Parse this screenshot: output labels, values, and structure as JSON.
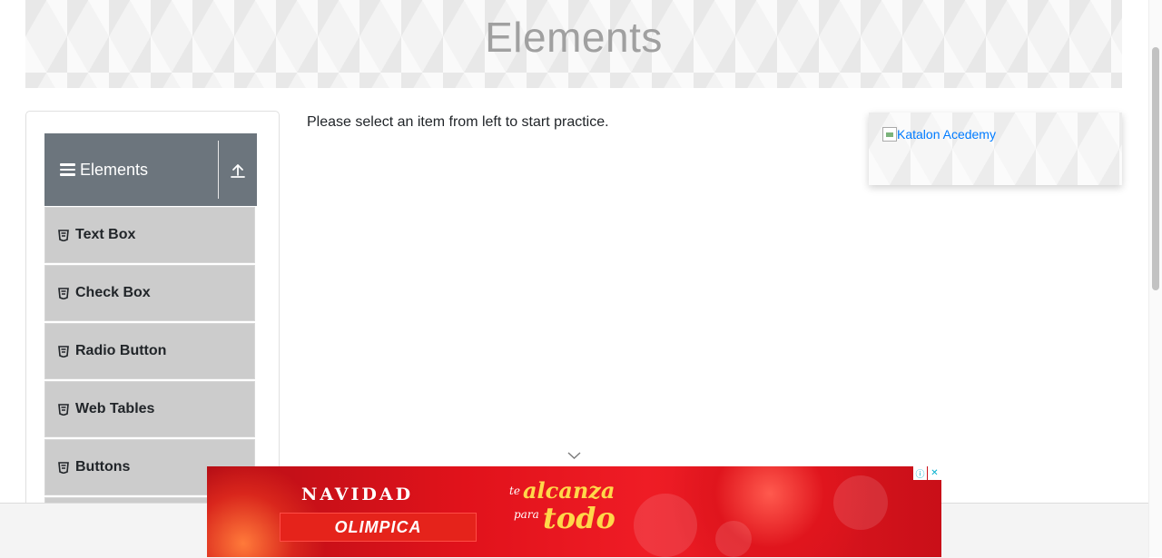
{
  "header": {
    "title": "Elements"
  },
  "sidebar": {
    "group_title": "Elements",
    "items": [
      {
        "label": "Text Box"
      },
      {
        "label": "Check Box"
      },
      {
        "label": "Radio Button"
      },
      {
        "label": "Web Tables"
      },
      {
        "label": "Buttons"
      }
    ]
  },
  "main": {
    "instruction": "Please select an item from left to start practice."
  },
  "sponsor": {
    "alt_text": "Katalon Acedemy"
  },
  "ad": {
    "headline": "NAVIDAD",
    "brand": "OLIMPICA",
    "slogan_line1_prefix": "te",
    "slogan_line1": "alcanza",
    "slogan_line2_prefix": "para",
    "slogan_line2": "todo"
  },
  "colors": {
    "group_header_bg": "#6c757d",
    "menu_item_bg": "#cccccc",
    "link": "#007bff",
    "ad_red": "#e1121b"
  }
}
